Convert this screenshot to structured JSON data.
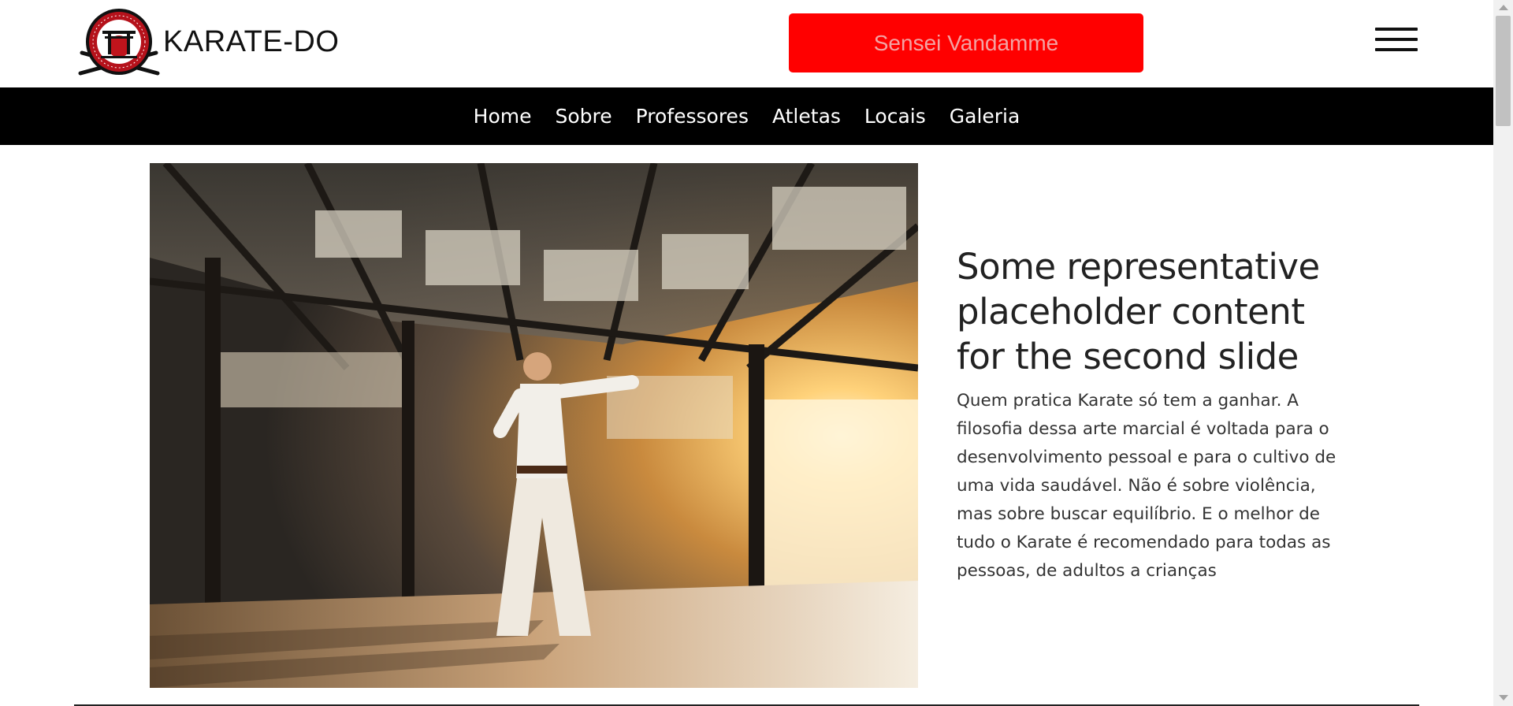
{
  "header": {
    "brand_title": "KARATE-DO",
    "logo_icon": "karate-dojo-logo",
    "cta_label": "Sensei Vandamme",
    "menu_icon": "hamburger-menu-icon",
    "accent_color": "#ff0000"
  },
  "nav": {
    "items": [
      {
        "label": "Home"
      },
      {
        "label": "Sobre"
      },
      {
        "label": "Professores"
      },
      {
        "label": "Atletas"
      },
      {
        "label": "Locais"
      },
      {
        "label": "Galeria"
      }
    ]
  },
  "slide": {
    "image": "karate-dojo-photo",
    "title": "Some representative placeholder content for the second slide",
    "body": "Quem pratica Karate só tem a ganhar. A filosofia dessa arte marcial é voltada para o desenvolvimento pessoal e para o cultivo de uma vida saudável. Não é sobre violência, mas sobre buscar equilíbrio. E o melhor de tudo o Karate é recomendado para todas as pessoas, de adultos a crianças"
  }
}
